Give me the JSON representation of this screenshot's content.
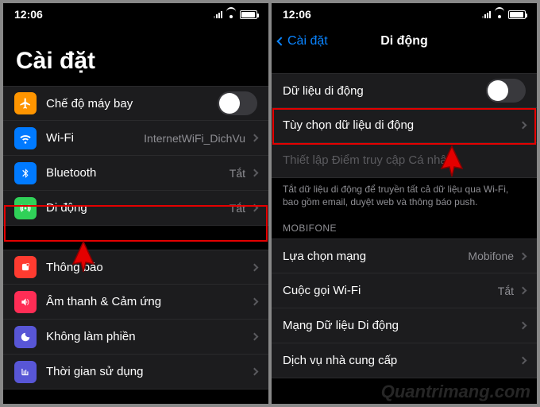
{
  "status": {
    "time": "12:06"
  },
  "left": {
    "title": "Cài đặt",
    "rows": {
      "airplane": {
        "label": "Chế độ máy bay",
        "toggle": false
      },
      "wifi": {
        "label": "Wi-Fi",
        "value": "InternetWiFi_DichVu"
      },
      "bt": {
        "label": "Bluetooth",
        "value": "Tắt"
      },
      "cellular": {
        "label": "Di động",
        "value": "Tắt"
      },
      "notif": {
        "label": "Thông báo"
      },
      "sound": {
        "label": "Âm thanh & Cảm ứng"
      },
      "dnd": {
        "label": "Không làm phiền"
      },
      "screentime": {
        "label": "Thời gian sử dụng"
      }
    }
  },
  "right": {
    "back": "Cài đặt",
    "title": "Di động",
    "rows": {
      "data": {
        "label": "Dữ liệu di động",
        "toggle": false
      },
      "options": {
        "label": "Tùy chọn dữ liệu di động"
      },
      "hotspot": {
        "label": "Thiết lập Điểm truy cập Cá nhân"
      },
      "footer1": "Tắt dữ liệu di động để truyền tất cả dữ liệu qua Wi-Fi, bao gồm email, duyệt web và thông báo push.",
      "carrierHeader": "MOBIFONE",
      "netsel": {
        "label": "Lựa chọn mạng",
        "value": "Mobifone"
      },
      "wificall": {
        "label": "Cuộc gọi Wi-Fi",
        "value": "Tắt"
      },
      "datanet": {
        "label": "Mạng Dữ liệu Di động"
      },
      "carrier": {
        "label": "Dịch vụ nhà cung cấp"
      }
    }
  },
  "watermark": "Quantrimang.com",
  "colors": {
    "airplane": "#ff9500",
    "wifi": "#007aff",
    "bt": "#007aff",
    "cellular": "#30d158",
    "notif": "#ff3b30",
    "sound": "#ff2d55",
    "dnd": "#5856d6",
    "screentime": "#5856d6"
  }
}
